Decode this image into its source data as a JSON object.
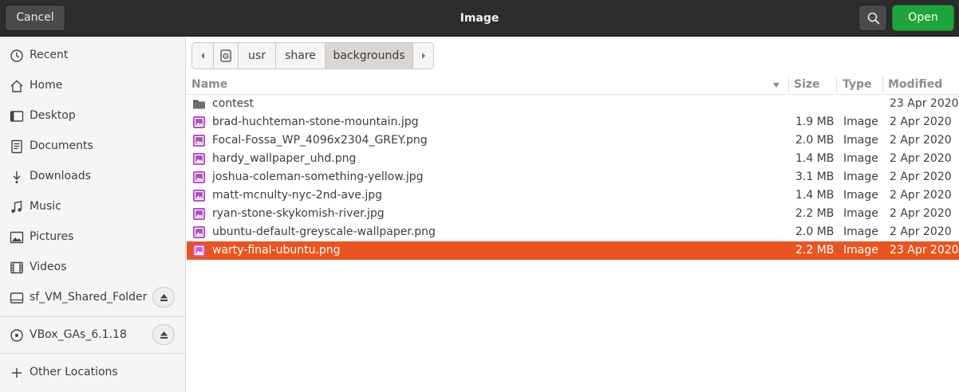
{
  "header": {
    "title": "Image",
    "cancel_label": "Cancel",
    "open_label": "Open"
  },
  "sidebar": {
    "items": [
      {
        "label": "Recent",
        "icon": "clock-icon"
      },
      {
        "label": "Home",
        "icon": "home-icon"
      },
      {
        "label": "Desktop",
        "icon": "desktop-icon"
      },
      {
        "label": "Documents",
        "icon": "document-icon"
      },
      {
        "label": "Downloads",
        "icon": "download-icon"
      },
      {
        "label": "Music",
        "icon": "music-icon"
      },
      {
        "label": "Pictures",
        "icon": "pictures-icon"
      },
      {
        "label": "Videos",
        "icon": "videos-icon"
      },
      {
        "label": "sf_VM_Shared_Folder",
        "icon": "drive-icon"
      },
      {
        "label": "VBox_GAs_6.1.18",
        "icon": "disc-icon"
      },
      {
        "label": "Other Locations",
        "icon": "plus-icon"
      }
    ]
  },
  "pathbar": {
    "segments": [
      "usr",
      "share",
      "backgrounds"
    ],
    "active": "backgrounds"
  },
  "filelist": {
    "columns": [
      "Name",
      "Size",
      "Type",
      "Modified"
    ],
    "rows": [
      {
        "name": "contest",
        "size": "",
        "type": "",
        "modified": "23 Apr 2020",
        "kind": "folder"
      },
      {
        "name": "brad-huchteman-stone-mountain.jpg",
        "size": "1.9 MB",
        "type": "Image",
        "modified": "2 Apr 2020",
        "kind": "image"
      },
      {
        "name": "Focal-Fossa_WP_4096x2304_GREY.png",
        "size": "2.0 MB",
        "type": "Image",
        "modified": "2 Apr 2020",
        "kind": "image"
      },
      {
        "name": "hardy_wallpaper_uhd.png",
        "size": "1.4 MB",
        "type": "Image",
        "modified": "2 Apr 2020",
        "kind": "image"
      },
      {
        "name": "joshua-coleman-something-yellow.jpg",
        "size": "3.1 MB",
        "type": "Image",
        "modified": "2 Apr 2020",
        "kind": "image"
      },
      {
        "name": "matt-mcnulty-nyc-2nd-ave.jpg",
        "size": "1.4 MB",
        "type": "Image",
        "modified": "2 Apr 2020",
        "kind": "image"
      },
      {
        "name": "ryan-stone-skykomish-river.jpg",
        "size": "2.2 MB",
        "type": "Image",
        "modified": "2 Apr 2020",
        "kind": "image"
      },
      {
        "name": "ubuntu-default-greyscale-wallpaper.png",
        "size": "2.0 MB",
        "type": "Image",
        "modified": "2 Apr 2020",
        "kind": "image"
      },
      {
        "name": "warty-final-ubuntu.png",
        "size": "2.2 MB",
        "type": "Image",
        "modified": "23 Apr 2020",
        "kind": "image",
        "selected": true
      }
    ]
  },
  "colors": {
    "selection": "#e95420",
    "open_button": "#1ea53a",
    "header_bg": "#2c2c2c"
  }
}
